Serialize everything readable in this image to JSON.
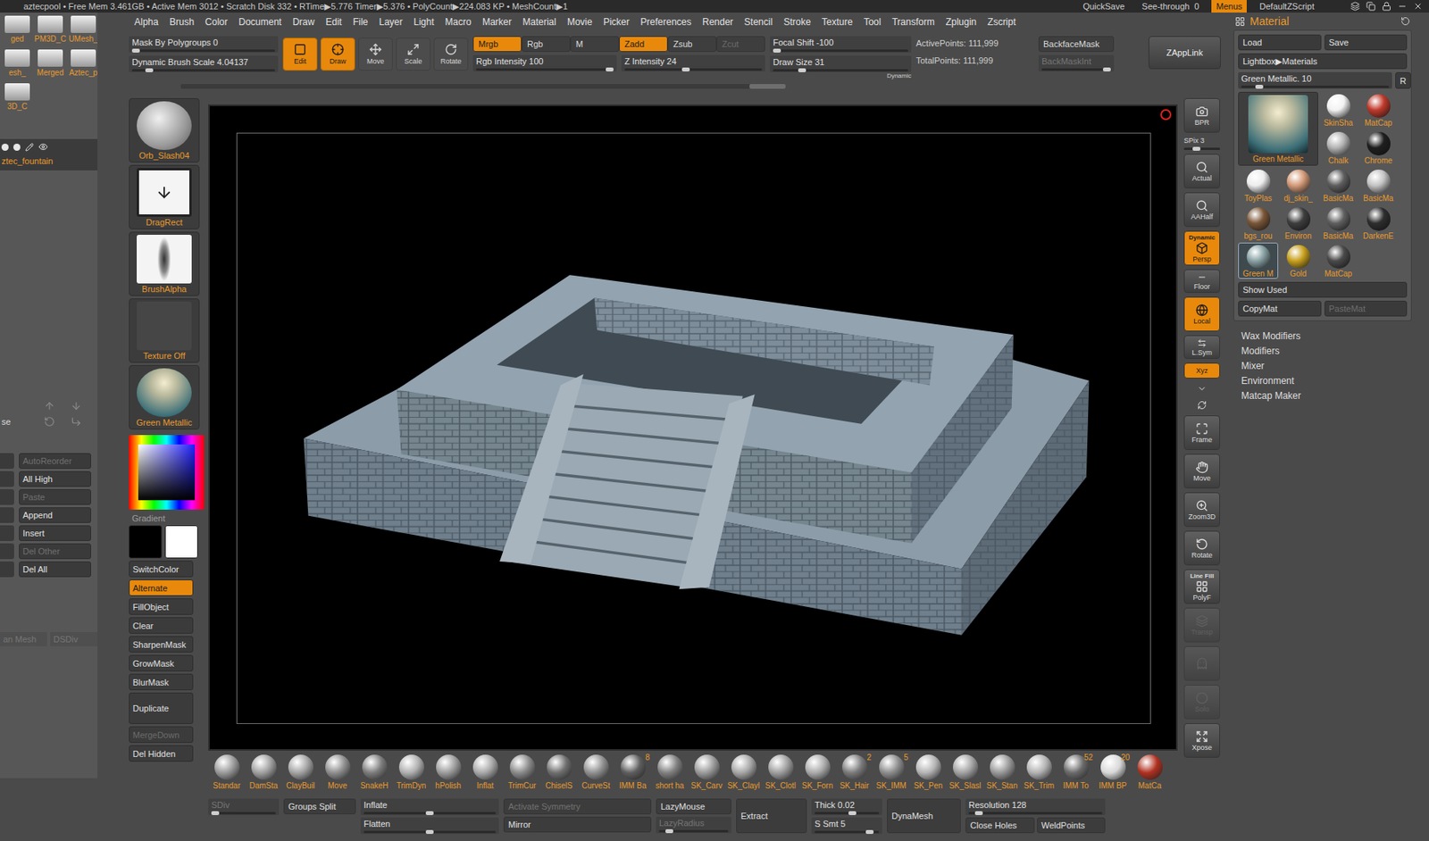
{
  "title_bar": {
    "status": "aztecpool  • Free Mem 3.461GB • Active Mem 3012 • Scratch Disk 332 • RTime▶5.776 Timer▶5.376 • PolyCount▶224.083 KP • MeshCount▶1",
    "items": [
      {
        "label": "QuickSave",
        "value": "",
        "selected": false
      },
      {
        "label": "See-through",
        "value": "0",
        "selected": false
      },
      {
        "label": "Menus",
        "value": "",
        "selected": true
      },
      {
        "label": "DefaultZScript",
        "value": "",
        "selected": false
      }
    ]
  },
  "menu": [
    "Alpha",
    "Brush",
    "Color",
    "Document",
    "Draw",
    "Edit",
    "File",
    "Layer",
    "Light",
    "Macro",
    "Marker",
    "Material",
    "Movie",
    "Picker",
    "Preferences",
    "Render",
    "Stencil",
    "Stroke",
    "Texture",
    "Tool",
    "Transform",
    "Zplugin",
    "Zscript"
  ],
  "left_panel": {
    "thumbnails": [
      {
        "label": "ged"
      },
      {
        "label": "PM3D_C"
      },
      {
        "label": "UMesh_"
      },
      {
        "label": "esh_"
      },
      {
        "label": "Merged"
      },
      {
        "label": "Aztec_p"
      },
      {
        "label": "3D_C"
      }
    ],
    "subtool": "ztec_fountain",
    "side_label": "se",
    "buttons": [
      {
        "label": "AutoReorder",
        "disabled": true
      },
      {
        "label": "All High",
        "disabled": false
      },
      {
        "label": "Paste",
        "disabled": true
      },
      {
        "label": "Append",
        "disabled": false
      },
      {
        "label": "Insert",
        "disabled": false
      },
      {
        "label": "Del Other",
        "disabled": true
      },
      {
        "label": "Del All",
        "disabled": false
      }
    ],
    "footer": [
      {
        "label": "an Mesh",
        "disabled": true
      },
      {
        "label": "DSDiv",
        "disabled": true
      }
    ]
  },
  "top_shelf": {
    "sliders_left": [
      {
        "label": "Mask By Polygroups",
        "value": "0",
        "level": 0
      },
      {
        "label": "Dynamic Brush Scale",
        "value": "4.04137",
        "level": 0.1
      }
    ],
    "modes": [
      {
        "label": "Edit",
        "selected": true
      },
      {
        "label": "Draw",
        "selected": true
      },
      {
        "label": "Move",
        "selected": false
      },
      {
        "label": "Scale",
        "selected": false
      },
      {
        "label": "Rotate",
        "selected": false
      }
    ],
    "channels": [
      {
        "label": "Mrgb",
        "selected": true,
        "disabled": false
      },
      {
        "label": "Rgb",
        "selected": false,
        "disabled": false
      },
      {
        "label": "M",
        "selected": false,
        "disabled": false
      },
      {
        "label": "Zadd",
        "selected": true,
        "disabled": false
      },
      {
        "label": "Zsub",
        "selected": false,
        "disabled": false
      },
      {
        "label": "Zcut",
        "selected": false,
        "disabled": true
      }
    ],
    "intensity": [
      {
        "label": "Rgb Intensity",
        "value": "100",
        "level": 1
      },
      {
        "label": "Z Intensity",
        "value": "24",
        "level": 0.44
      }
    ],
    "focal": {
      "label": "Focal Shift",
      "value": "-100",
      "level": 0
    },
    "draw_size": {
      "label": "Draw Size",
      "value": "31",
      "level": 0.2
    },
    "dynamic_label": "Dynamic",
    "points": [
      {
        "label": "ActivePoints:",
        "value": "111,999"
      },
      {
        "label": "TotalPoints:",
        "value": "111,999"
      }
    ],
    "backface_mask": {
      "label": "BackfaceMask",
      "selected": false
    },
    "back_mask_int": {
      "label": "BackMaskInt",
      "disabled": true,
      "level": 1
    },
    "zapplink": "ZAppLink"
  },
  "left_shelf": {
    "thumbnails": [
      {
        "label": "Orb_Slash04"
      },
      {
        "label": "DragRect"
      },
      {
        "label": "BrushAlpha"
      },
      {
        "label": "Texture Off"
      },
      {
        "label": "Green Metallic"
      }
    ],
    "gradient": "Gradient",
    "main_color": "#000000",
    "secondary_color": "#ffffff",
    "buttons": [
      {
        "label": "SwitchColor",
        "kind": "button",
        "selected": false,
        "disabled": false
      },
      {
        "label": "Alternate",
        "kind": "button",
        "selected": true,
        "disabled": false
      },
      {
        "label": "FillObject",
        "kind": "button",
        "selected": false,
        "disabled": false
      },
      {
        "label": "Clear",
        "kind": "button",
        "selected": false,
        "disabled": false
      },
      {
        "label": "SharpenMask",
        "kind": "button",
        "selected": false,
        "disabled": false
      },
      {
        "label": "GrowMask",
        "kind": "button",
        "selected": false,
        "disabled": false
      },
      {
        "label": "BlurMask",
        "kind": "button",
        "selected": false,
        "disabled": false
      },
      {
        "label": "Duplicate",
        "kind": "tall",
        "selected": false,
        "disabled": false
      },
      {
        "label": "MergeDown",
        "kind": "button",
        "selected": false,
        "disabled": true
      },
      {
        "label": "Del Hidden",
        "kind": "button",
        "selected": false,
        "disabled": false
      }
    ]
  },
  "right_shelf": [
    {
      "label": "BPR",
      "value": "",
      "badge": "",
      "kind": "big",
      "selected": false,
      "disabled": false,
      "level": 0
    },
    {
      "label": "SPix",
      "value": "3",
      "badge": "",
      "kind": "slider",
      "selected": false,
      "disabled": false,
      "level": 0.3
    },
    {
      "label": "Actual",
      "value": "",
      "badge": "",
      "kind": "big",
      "selected": false,
      "disabled": false,
      "level": 0
    },
    {
      "label": "AAHalf",
      "value": "",
      "badge": "",
      "kind": "big",
      "selected": false,
      "disabled": false,
      "level": 0
    },
    {
      "label": "Persp",
      "value": "",
      "badge": "Dynamic",
      "kind": "big",
      "selected": true,
      "disabled": false,
      "level": 0
    },
    {
      "label": "Floor",
      "value": "",
      "badge": "",
      "kind": "medium",
      "selected": false,
      "disabled": false,
      "level": 0
    },
    {
      "label": "Local",
      "value": "",
      "badge": "",
      "kind": "big",
      "selected": true,
      "disabled": false,
      "level": 0
    },
    {
      "label": "L.Sym",
      "value": "",
      "badge": "",
      "kind": "medium",
      "selected": false,
      "disabled": false,
      "level": 0
    },
    {
      "label": "Xyz",
      "value": "",
      "badge": "",
      "kind": "small",
      "selected": true,
      "disabled": false,
      "level": 0
    },
    {
      "label": "",
      "value": "",
      "badge": "",
      "kind": "mini",
      "selected": false,
      "disabled": false,
      "level": 0
    },
    {
      "label": "",
      "value": "",
      "badge": "",
      "kind": "mini",
      "selected": false,
      "disabled": false,
      "level": 0
    },
    {
      "label": "Frame",
      "value": "",
      "badge": "",
      "kind": "big",
      "selected": false,
      "disabled": false,
      "level": 0
    },
    {
      "label": "Move",
      "value": "",
      "badge": "",
      "kind": "big",
      "selected": false,
      "disabled": false,
      "level": 0
    },
    {
      "label": "Zoom3D",
      "value": "",
      "badge": "",
      "kind": "big",
      "selected": false,
      "disabled": false,
      "level": 0
    },
    {
      "label": "Rotate",
      "value": "",
      "badge": "",
      "kind": "big",
      "selected": false,
      "disabled": false,
      "level": 0
    },
    {
      "label": "PolyF",
      "value": "",
      "badge": "Line Fill",
      "kind": "big",
      "selected": false,
      "disabled": false,
      "level": 0
    },
    {
      "label": "Transp",
      "value": "",
      "badge": "",
      "kind": "big",
      "selected": false,
      "disabled": true,
      "level": 0
    },
    {
      "label": "",
      "value": "",
      "badge": "",
      "kind": "big",
      "selected": false,
      "disabled": true,
      "level": 0
    },
    {
      "label": "Solo",
      "value": "",
      "badge": "",
      "kind": "big",
      "selected": false,
      "disabled": true,
      "level": 0
    },
    {
      "label": "Xpose",
      "value": "",
      "badge": "",
      "kind": "big",
      "selected": false,
      "disabled": false,
      "level": 0
    }
  ],
  "brushes": [
    {
      "label": "Standar",
      "count": "",
      "color": "#9a9a9a"
    },
    {
      "label": "DamSta",
      "count": "",
      "color": "#a0a0a0"
    },
    {
      "label": "ClayBuil",
      "count": "",
      "color": "#a4a4a4"
    },
    {
      "label": "Move",
      "count": "",
      "color": "#8e8e8e"
    },
    {
      "label": "SnakeH",
      "count": "",
      "color": "#7c7c7c"
    },
    {
      "label": "TrimDyn",
      "count": "",
      "color": "#b0b0b0"
    },
    {
      "label": "hPolish",
      "count": "",
      "color": "#9c9c9c"
    },
    {
      "label": "Inflat",
      "count": "",
      "color": "#a8a8a8"
    },
    {
      "label": "TrimCur",
      "count": "",
      "color": "#8a8a8a"
    },
    {
      "label": "ChiselS",
      "count": "",
      "color": "#6f6f6f"
    },
    {
      "label": "CurveSt",
      "count": "",
      "color": "#909090"
    },
    {
      "label": "IMM Ba",
      "count": "8",
      "color": "#5e5e5e"
    },
    {
      "label": "short ha",
      "count": "",
      "color": "#808080"
    },
    {
      "label": "SK_Carv",
      "count": "",
      "color": "#9a9a9a"
    },
    {
      "label": "SK_Clayl",
      "count": "",
      "color": "#a6a6a6"
    },
    {
      "label": "SK_Clotl",
      "count": "",
      "color": "#9e9e9e"
    },
    {
      "label": "SK_Forn",
      "count": "",
      "color": "#aaaaaa"
    },
    {
      "label": "SK_Hair",
      "count": "2",
      "color": "#7a7a7a"
    },
    {
      "label": "SK_IMM",
      "count": "5",
      "color": "#8c8c8c"
    },
    {
      "label": "SK_Pen",
      "count": "",
      "color": "#b4b4b4"
    },
    {
      "label": "SK_Slasl",
      "count": "",
      "color": "#a2a2a2"
    },
    {
      "label": "SK_Stan",
      "count": "",
      "color": "#989898"
    },
    {
      "label": "SK_Trim",
      "count": "",
      "color": "#b2b2b2"
    },
    {
      "label": "IMM To",
      "count": "52",
      "color": "#6a6a6a"
    },
    {
      "label": "IMM BP",
      "count": "20",
      "color": "#d8d8d8"
    },
    {
      "label": "MatCa",
      "count": "",
      "color": "#b03020"
    }
  ],
  "controls": [
    {
      "width": 90,
      "rows": [
        [
          {
            "kind": "slider",
            "label": "SDiv",
            "value": "",
            "level": 0,
            "selected": false,
            "disabled": true
          }
        ]
      ]
    },
    {
      "width": 92,
      "rows": [
        [
          {
            "kind": "button",
            "label": "Groups Split",
            "value": "",
            "level": 0,
            "selected": false,
            "disabled": false
          }
        ]
      ]
    },
    {
      "width": 176,
      "rows": [
        [
          {
            "kind": "slider",
            "label": "Inflate",
            "value": "",
            "level": 0.5,
            "selected": false,
            "disabled": false
          }
        ],
        [
          {
            "kind": "slider",
            "label": "Flatten",
            "value": "",
            "level": 0.5,
            "selected": false,
            "disabled": false
          }
        ]
      ]
    },
    {
      "width": 188,
      "rows": [
        [
          {
            "kind": "button",
            "label": "Activate Symmetry",
            "value": "",
            "level": 0,
            "selected": false,
            "disabled": true
          }
        ],
        [
          {
            "kind": "button",
            "label": "Mirror",
            "value": "",
            "level": 0,
            "selected": false,
            "disabled": false
          }
        ]
      ]
    },
    {
      "width": 96,
      "rows": [
        [
          {
            "kind": "button",
            "label": "LazyMouse",
            "value": "",
            "level": 0,
            "selected": false,
            "disabled": false
          }
        ],
        [
          {
            "kind": "slider",
            "label": "LazyRadius",
            "value": "",
            "level": 0.1,
            "selected": false,
            "disabled": true
          }
        ]
      ]
    },
    {
      "width": 90,
      "rows": [
        [
          {
            "kind": "tall",
            "label": "Extract",
            "value": "",
            "level": 0,
            "selected": false,
            "disabled": false
          }
        ]
      ]
    },
    {
      "width": 90,
      "rows": [
        [
          {
            "kind": "slider",
            "label": "Thick",
            "value": "0.02",
            "level": 0.6,
            "selected": false,
            "disabled": false
          }
        ],
        [
          {
            "kind": "slider",
            "label": "S Smt",
            "value": "5",
            "level": 0.9,
            "selected": false,
            "disabled": false
          }
        ]
      ]
    },
    {
      "width": 94,
      "rows": [
        [
          {
            "kind": "tall",
            "label": "DynaMesh",
            "value": "",
            "level": 0,
            "selected": false,
            "disabled": false
          }
        ]
      ]
    },
    {
      "width": 178,
      "rows": [
        [
          {
            "kind": "slider",
            "label": "Resolution",
            "value": "128",
            "level": 0.05,
            "selected": false,
            "disabled": false
          }
        ],
        [
          {
            "kind": "button",
            "label": "Close Holes",
            "value": "",
            "level": 0,
            "selected": false,
            "disabled": false
          },
          {
            "kind": "button",
            "label": "WeldPoints",
            "value": "",
            "level": 0,
            "selected": false,
            "disabled": false
          }
        ]
      ]
    }
  ],
  "material_panel": {
    "title": "Material",
    "buttons": [
      {
        "label": "Load"
      },
      {
        "label": "Save"
      }
    ],
    "lightbox": "Lightbox▶Materials",
    "slider": {
      "label": "Green Metallic.",
      "value": "10",
      "level": 0.1
    },
    "reset": "R",
    "current": {
      "label": "Green Metallic",
      "color": "#3c6f78"
    },
    "swatches": [
      {
        "label": "SkinSha",
        "color": "#f2f2f2",
        "selected": false
      },
      {
        "label": "MatCap",
        "color": "#c0392b",
        "selected": false
      },
      {
        "label": "Chalk",
        "color": "#b4b4b4",
        "selected": false
      },
      {
        "label": "Chrome",
        "color": "#1e1e1e",
        "selected": false
      },
      {
        "label": "ToyPlas",
        "color": "#ededed",
        "selected": false
      },
      {
        "label": "dj_skin_",
        "color": "#d49a78",
        "selected": false
      },
      {
        "label": "BasicMa",
        "color": "#5e5e5e",
        "selected": false
      },
      {
        "label": "BasicMa",
        "color": "#c4c4c4",
        "selected": false
      },
      {
        "label": "bgs_rou",
        "color": "#7a5638",
        "selected": false
      },
      {
        "label": "Environ",
        "color": "#3e3e3e",
        "selected": false
      },
      {
        "label": "BasicMa",
        "color": "#606060",
        "selected": false
      },
      {
        "label": "DarkenE",
        "color": "#2e2e2e",
        "selected": false
      },
      {
        "label": "Green M",
        "color": "#8aa3a6",
        "selected": true
      },
      {
        "label": "Gold",
        "color": "#c9a11e",
        "selected": false
      },
      {
        "label": "MatCap",
        "color": "#4a4a4a",
        "selected": false
      }
    ],
    "show_used": "Show Used",
    "copy": [
      {
        "label": "CopyMat",
        "disabled": false
      },
      {
        "label": "PasteMat",
        "disabled": true
      }
    ],
    "subpalettes": [
      "Wax Modifiers",
      "Modifiers",
      "Mixer",
      "Environment",
      "Matcap Maker"
    ]
  }
}
